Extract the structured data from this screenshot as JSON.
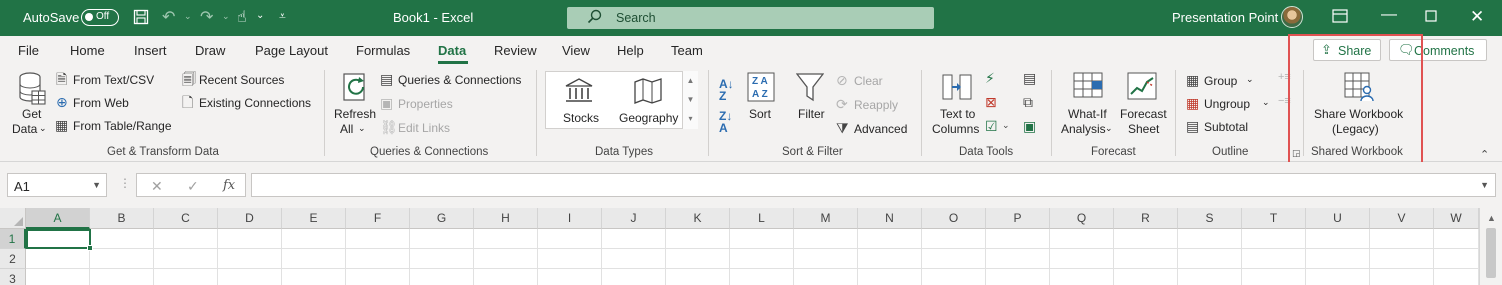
{
  "titlebar": {
    "autosave_label": "AutoSave",
    "autosave_state": "Off",
    "doc_title": "Book1  -  Excel",
    "search_placeholder": "Search",
    "user_name": "Presentation Point",
    "bg_color": "#217346"
  },
  "tabs": [
    "File",
    "Home",
    "Insert",
    "Draw",
    "Page Layout",
    "Formulas",
    "Data",
    "Review",
    "View",
    "Help",
    "Team"
  ],
  "active_tab": "Data",
  "share_label": "Share",
  "comments_label": "Comments",
  "ribbon": {
    "get_transform": {
      "get_data": [
        "Get",
        "Data"
      ],
      "from_text_csv": "From Text/CSV",
      "from_web": "From Web",
      "from_table_range": "From Table/Range",
      "recent_sources": "Recent Sources",
      "existing_connections": "Existing Connections",
      "group_label": "Get & Transform Data"
    },
    "queries": {
      "refresh_all": [
        "Refresh",
        "All"
      ],
      "queries_connections": "Queries & Connections",
      "properties": "Properties",
      "edit_links": "Edit Links",
      "group_label": "Queries & Connections"
    },
    "data_types": {
      "stocks": "Stocks",
      "geography": "Geography",
      "group_label": "Data Types"
    },
    "sort_filter": {
      "sort": "Sort",
      "filter": "Filter",
      "clear": "Clear",
      "reapply": "Reapply",
      "advanced": "Advanced",
      "group_label": "Sort & Filter"
    },
    "data_tools": {
      "text_to_columns": [
        "Text to",
        "Columns"
      ],
      "group_label": "Data Tools"
    },
    "forecast": {
      "what_if": [
        "What-If",
        "Analysis"
      ],
      "forecast_sheet": [
        "Forecast",
        "Sheet"
      ],
      "group_label": "Forecast"
    },
    "outline": {
      "group": "Group",
      "ungroup": "Ungroup",
      "subtotal": "Subtotal",
      "group_label": "Outline"
    },
    "shared_workbook": {
      "share_workbook": [
        "Share Workbook",
        "(Legacy)"
      ],
      "group_label": "Shared Workbook"
    }
  },
  "formula_bar": {
    "name_box": "A1",
    "fx": "fx",
    "value": ""
  },
  "grid": {
    "columns": [
      "A",
      "B",
      "C",
      "D",
      "E",
      "F",
      "G",
      "H",
      "I",
      "J",
      "K",
      "L",
      "M",
      "N",
      "O",
      "P",
      "Q",
      "R",
      "S",
      "T",
      "U",
      "V",
      "W"
    ],
    "rows": [
      "1",
      "2",
      "3"
    ],
    "active_cell": "A1"
  },
  "highlight_color": "#e05252"
}
